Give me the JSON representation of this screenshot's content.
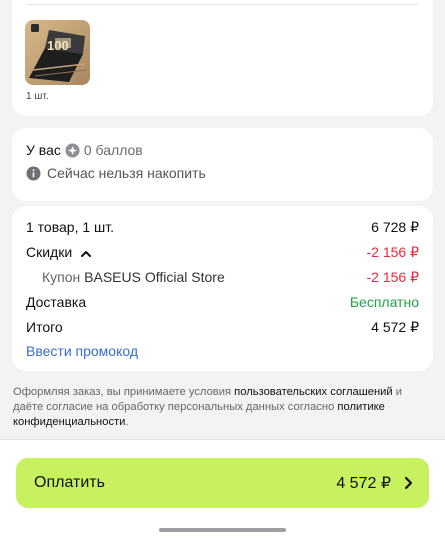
{
  "product": {
    "thumbnail_icon": "product-thumbnail",
    "quantity": "1 шт."
  },
  "bonus": {
    "prefix": "У вас",
    "coin_icon": "coin-icon",
    "value": "0 баллов",
    "info_icon": "info-icon",
    "notice": "Сейчас нельзя накопить"
  },
  "summary": {
    "items_label": "1 товар, 1 шт.",
    "items_value": "6 728 ₽",
    "discounts_label": "Скидки",
    "discounts_value": "-2 156 ₽",
    "coupon_prefix": "Купон",
    "coupon_name": "BASEUS Official Store",
    "coupon_value": "-2 156 ₽",
    "delivery_label": "Доставка",
    "delivery_value": "Бесплатно",
    "total_label": "Итого",
    "total_value": "4 572 ₽",
    "promo_link": "Ввести промокод"
  },
  "legal": {
    "part1": "Оформляя заказ, вы принимаете условия ",
    "link1": "пользовательских соглашений",
    "part2": " и даёте согласие на обработку персональных данных согласно ",
    "link2": "политике конфиденциальности",
    "part3": "."
  },
  "pay": {
    "label": "Оплатить",
    "amount": "4 572 ₽"
  },
  "colors": {
    "accent_button": "#c7f15f",
    "negative": "#f0263c",
    "positive": "#1fa442",
    "link": "#3b6bd6"
  }
}
